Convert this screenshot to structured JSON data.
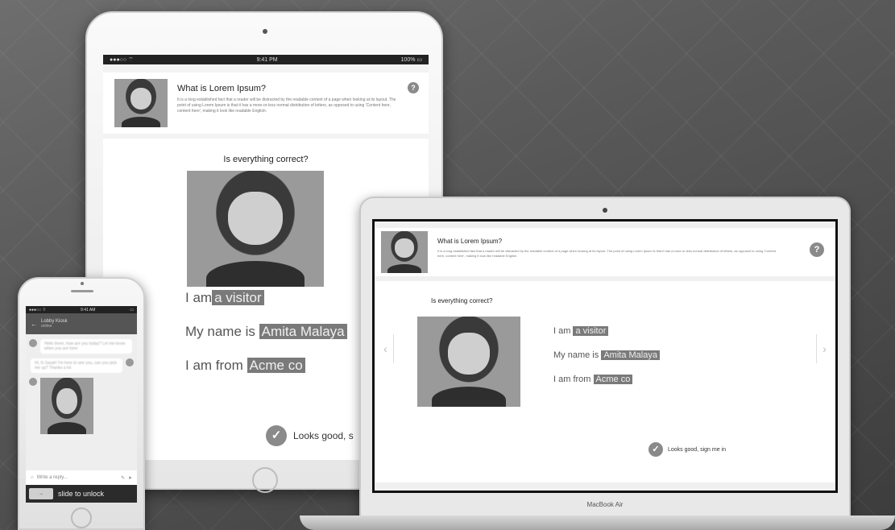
{
  "question_card": {
    "title": "What is Lorem Ipsum?",
    "description": "It is a long established fact that a reader will be distracted by the readable content of a page when looking at its layout. The point of using Lorem Ipsum is that it has a more-or-less normal distribution of letters, as opposed to using 'Content here, content here', making it look like readable English.",
    "help": "?"
  },
  "verify": {
    "question": "Is everything correct?",
    "role_prefix": "I am",
    "role_value": "a visitor",
    "name_prefix": "My name is",
    "name_value": "Amita Malaya",
    "from_prefix": "I am from",
    "from_value": "Acme co",
    "confirm_tablet": "Looks good, s",
    "confirm_laptop": "Looks good, sign me in",
    "check_glyph": "✓"
  },
  "laptop": {
    "brand": "MacBook Air",
    "prev": "‹",
    "next": "›"
  },
  "tablet_status": {
    "left": "●●●○○ ⌔",
    "center": "9:41 PM",
    "right": "100% ▭"
  },
  "phone": {
    "status_left": "●●●○○ ⌔",
    "status_center": "9:41 AM",
    "status_right": "▭",
    "header_title": "Lobby Kiosk",
    "header_sub": "online",
    "back": "←",
    "messages": [
      "Hello there, how are you today? Let me know when you are here",
      "Hi, hi Sarah! I'm here to see you, can you pick me up? Thanks a lot"
    ],
    "compose_placeholder": "Write a reply...",
    "slide_knob": "→",
    "slide_label": "slide to unlock"
  }
}
